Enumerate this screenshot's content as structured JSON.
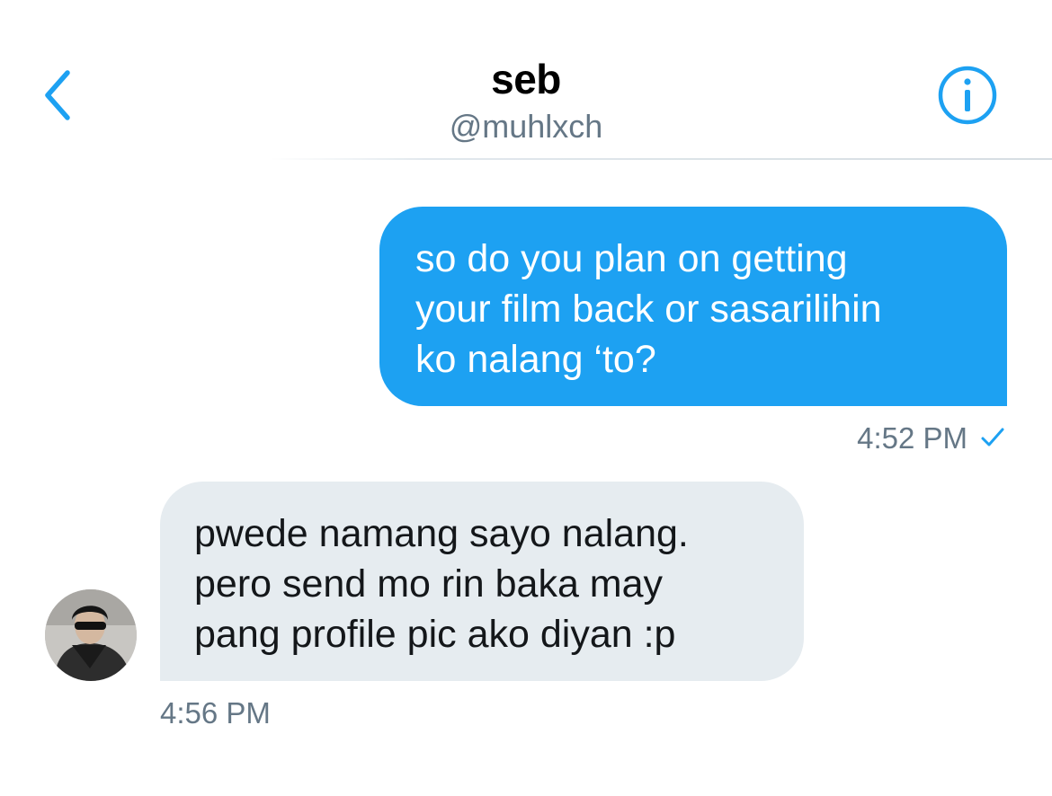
{
  "header": {
    "name": "seb",
    "handle": "@muhlxch",
    "accent_color": "#1da1f2",
    "back_icon": "chevron-left-icon",
    "info_icon": "info-circle-icon"
  },
  "messages": [
    {
      "direction": "outgoing",
      "lines": [
        "so do you plan on getting",
        "your film back or sasarilihin",
        "ko nalang ‘to?"
      ],
      "time": "4:52 PM",
      "status_icon": "checkmark-icon"
    },
    {
      "direction": "incoming",
      "lines": [
        "pwede namang sayo nalang.",
        "pero send mo rin baka may",
        "pang profile pic ako diyan :p"
      ],
      "time": "4:56 PM"
    }
  ]
}
